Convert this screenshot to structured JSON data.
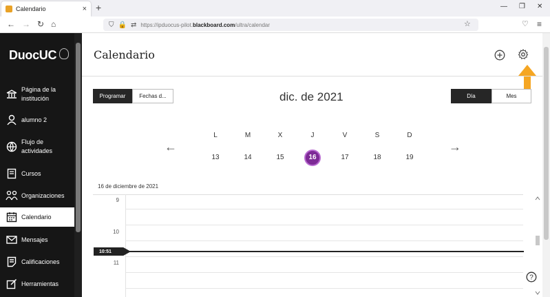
{
  "browser": {
    "tab_title": "Calendario",
    "tab_close": "×",
    "new_tab": "+",
    "url_prefix": "https://ipduocus-pilot.",
    "url_host": "blackboard.com",
    "url_path": "/ultra/calendar",
    "window_minimize": "—",
    "window_restore": "❐",
    "window_close": "✕"
  },
  "sidebar": {
    "logo": "DuocUC",
    "items": [
      {
        "label": "Página de la institución",
        "icon": "institution-icon"
      },
      {
        "label": "alumno 2",
        "icon": "user-icon"
      },
      {
        "label": "Flujo de actividades",
        "icon": "globe-icon"
      },
      {
        "label": "Cursos",
        "icon": "courses-icon"
      },
      {
        "label": "Organizaciones",
        "icon": "organizations-icon"
      },
      {
        "label": "Calendario",
        "icon": "calendar-icon"
      },
      {
        "label": "Mensajes",
        "icon": "mail-icon"
      },
      {
        "label": "Calificaciones",
        "icon": "grades-icon"
      },
      {
        "label": "Herramientas",
        "icon": "tools-icon"
      }
    ]
  },
  "main": {
    "title": "Calendario",
    "programar": "Programar",
    "fechas": "Fechas d...",
    "month": "dic. de 2021",
    "dia": "Día",
    "mes": "Mes",
    "prev": "←",
    "next": "→",
    "days": [
      {
        "letter": "L",
        "num": "13"
      },
      {
        "letter": "M",
        "num": "14"
      },
      {
        "letter": "X",
        "num": "15"
      },
      {
        "letter": "J",
        "num": "16"
      },
      {
        "letter": "V",
        "num": "17"
      },
      {
        "letter": "S",
        "num": "18"
      },
      {
        "letter": "D",
        "num": "19"
      }
    ],
    "selected_day_index": 3,
    "date_label": "16 de diciembre de 2021",
    "hours": [
      "9",
      "10",
      "11"
    ],
    "now": "10:51",
    "help": "?"
  },
  "colors": {
    "sidebar_bg": "#161616",
    "selected_day": "#7d2a96",
    "annotation_arrow": "#f5a623"
  }
}
